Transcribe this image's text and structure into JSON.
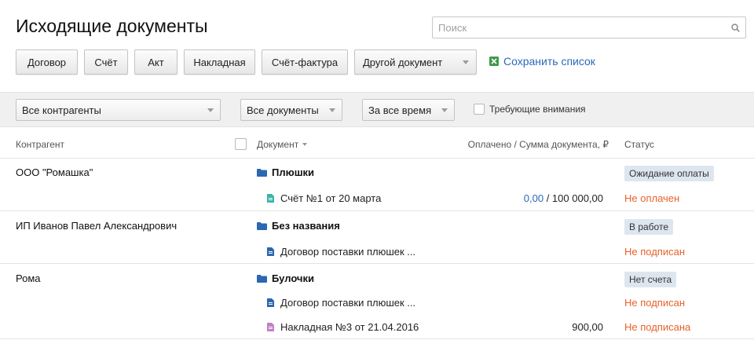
{
  "page": {
    "title": "Исходящие документы"
  },
  "search": {
    "placeholder": "Поиск"
  },
  "doc_buttons": [
    "Договор",
    "Счёт",
    "Акт",
    "Накладная",
    "Счёт-фактура",
    "Другой документ"
  ],
  "save_list": {
    "label": "Сохранить список",
    "icon": "xls-icon"
  },
  "filters": {
    "contractors": "Все контрагенты",
    "documents": "Все документы",
    "period": "За все время",
    "attention_label": "Требующие внимания",
    "attention_checked": false
  },
  "columns": {
    "contractor": "Контрагент",
    "document": "Документ",
    "paid_sum": "Оплачено / Сумма документа, ₽",
    "status": "Статус"
  },
  "groups": [
    {
      "contractor": "ООО \"Ромашка\"",
      "folder": "Плюшки",
      "badge": "Ожидание оплаты",
      "docs": [
        {
          "icon": "invoice-icon",
          "color": "#3bb3a7",
          "name": "Счёт №1 от 20 марта",
          "paid": "0,00",
          "total": " / 100 000,00",
          "status": "Не оплачен"
        }
      ]
    },
    {
      "contractor": "ИП Иванов Павел Александрович",
      "folder": "Без названия",
      "badge": "В работе",
      "docs": [
        {
          "icon": "contract-icon",
          "color": "#2c67b1",
          "name": "Договор поставки плюшек ...",
          "paid": "",
          "total": "",
          "status": "Не подписан"
        }
      ]
    },
    {
      "contractor": "Рома",
      "folder": "Булочки",
      "badge": "Нет счета",
      "docs": [
        {
          "icon": "contract-icon",
          "color": "#2c67b1",
          "name": "Договор поставки плюшек ...",
          "paid": "",
          "total": "",
          "status": "Не подписан"
        },
        {
          "icon": "waybill-icon",
          "color": "#c27fc7",
          "name": "Накладная №3 от 21.04.2016",
          "paid": "",
          "total": "900,00",
          "status": "Не подписана"
        }
      ]
    }
  ],
  "colors": {
    "accent": "#2a6ab8",
    "status_warning": "#e8612c",
    "badge_bg": "#dde6ef",
    "folder": "#2c67b1"
  }
}
